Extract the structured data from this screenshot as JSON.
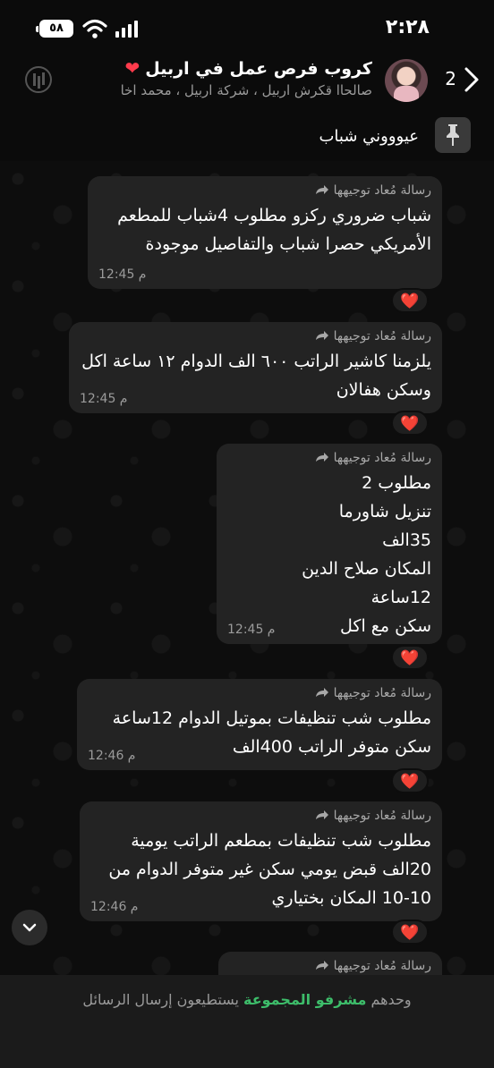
{
  "status_bar": {
    "time": "٢:٢٨",
    "battery": "٥٨"
  },
  "header": {
    "back_count": "2",
    "title": "كروب فرص عمل في اربيل",
    "members": "صالحاا قكرش اربيل ، شركة اربيل ، محمد اخا"
  },
  "pinned": {
    "text": "عيوووني شباب"
  },
  "forwarded_label": "رسالة مُعاد توجيهها",
  "messages": [
    {
      "body": "شباب ضروري ركزو مطلوب 4شباب للمطعم\nالأمريكي حصرا شباب والتفاصيل موجودة",
      "time": "12:45 م",
      "reaction": "❤️"
    },
    {
      "body": "يلزمنا كاشير الراتب ٦٠٠ الف الدوام ١٢ ساعة اكل\nوسكن هفالان",
      "time": "12:45 م",
      "reaction": "❤️"
    },
    {
      "body": "مطلوب 2\nتنزيل شاورما\n35الف\nالمكان صلاح الدين\n12ساعة\nسكن مع اكل",
      "time": "12:45 م",
      "reaction": "❤️"
    },
    {
      "body": "مطلوب شب تنظيفات بموتيل  الدوام 12ساعة\nسكن متوفر الراتب 400الف",
      "time": "12:46 م",
      "reaction": "❤️"
    },
    {
      "body": "مطلوب شب تنظيفات بمطعم الراتب يومية\n20الف قبض يومي سكن غير متوفر الدوام من\n10-10 المكان بختياري",
      "time": "12:46 م",
      "reaction": "❤️"
    }
  ],
  "footer": {
    "prefix": "وحدهم",
    "link": "مشرفو المجموعة",
    "suffix": "يستطيعون إرسال الرسائل"
  },
  "colors": {
    "accent": "#3dbd6a",
    "bubble": "#232323",
    "heart": "#ff2f45"
  }
}
